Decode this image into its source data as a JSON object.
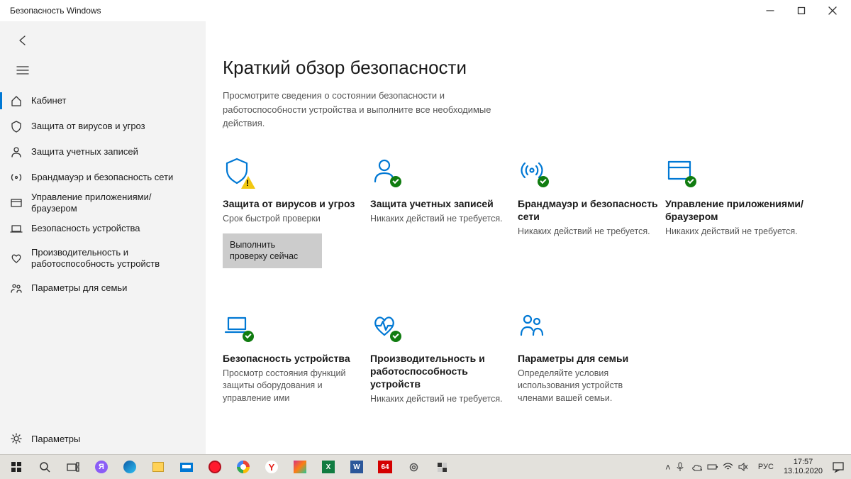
{
  "window": {
    "title": "Безопасность Windows"
  },
  "sidebar": {
    "items": [
      {
        "label": "Кабинет"
      },
      {
        "label": "Защита от вирусов и угроз"
      },
      {
        "label": "Защита учетных записей"
      },
      {
        "label": "Брандмауэр и безопасность сети"
      },
      {
        "label": "Управление приложениями/браузером"
      },
      {
        "label": "Безопасность устройства"
      },
      {
        "label": "Производительность и работоспособность устройств"
      },
      {
        "label": "Параметры для семьи"
      }
    ],
    "settings_label": "Параметры"
  },
  "main": {
    "title": "Краткий обзор безопасности",
    "subtitle": "Просмотрите сведения о состоянии безопасности и работоспособности устройства и выполните все необходимые действия."
  },
  "cards": [
    {
      "title": "Защита от вирусов и угроз",
      "status": "Срок быстрой проверки",
      "button": "Выполнить проверку сейчас",
      "badge": "warn"
    },
    {
      "title": "Защита учетных записей",
      "status": "Никаких действий не требуется.",
      "badge": "ok"
    },
    {
      "title": "Брандмауэр и безопасность сети",
      "status": "Никаких действий не требуется.",
      "badge": "ok"
    },
    {
      "title": "Управление приложениями/браузером",
      "status": "Никаких действий не требуется.",
      "badge": "ok"
    },
    {
      "title": "Безопасность устройства",
      "status": "Просмотр состояния функций защиты оборудования и управление ими",
      "badge": "ok"
    },
    {
      "title": "Производительность и работоспособность устройств",
      "status": "Никаких действий не требуется.",
      "badge": "ok"
    },
    {
      "title": "Параметры для семьи",
      "status": "Определяйте условия использования устройств членами вашей семьи.",
      "badge": "none"
    }
  ],
  "tray": {
    "lang": "РУС",
    "time": "17:57",
    "date": "13.10.2020"
  }
}
